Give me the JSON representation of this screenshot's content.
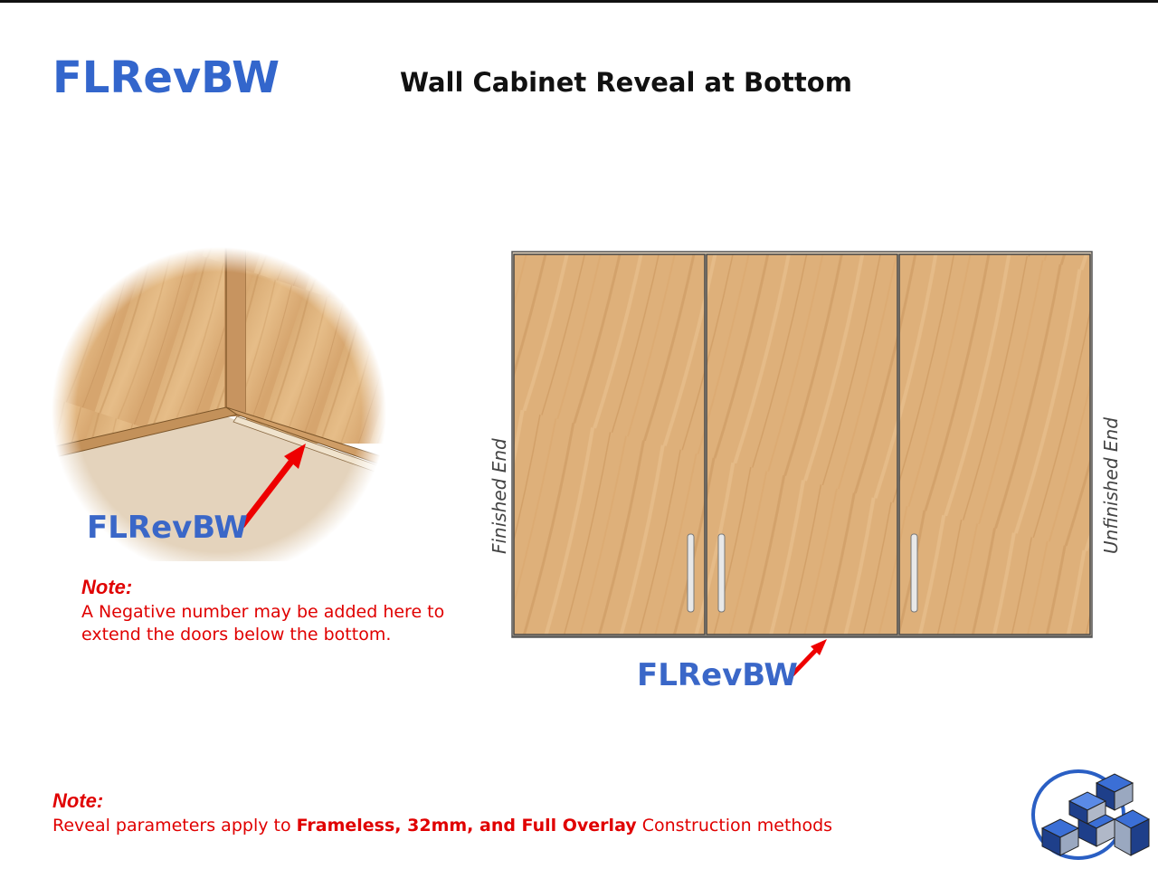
{
  "header": {
    "code": "FLRevBW",
    "title": "Wall Cabinet Reveal at Bottom"
  },
  "detail": {
    "label": "FLRevBW"
  },
  "detail_note": {
    "heading": "Note:",
    "line1": "A Negative number may be added here to",
    "line2": "extend the doors below the bottom."
  },
  "cabinet": {
    "left_side_label": "Finished End",
    "right_side_label": "Unfinished End",
    "reveal_label": "FLRevBW",
    "door_count": 3
  },
  "footer_note": {
    "heading": "Note:",
    "prefix": "Reveal parameters apply to",
    "bold": "Frameless,  32mm,  and Full Overlay",
    "suffix": "Construction methods"
  },
  "colors": {
    "accent_blue": "#3a67c8",
    "note_red": "#e00000",
    "arrow_red": "#ee0000",
    "wood": "#deb07a"
  },
  "icons": [
    "logo-cubes-icon",
    "red-arrow-icon"
  ]
}
